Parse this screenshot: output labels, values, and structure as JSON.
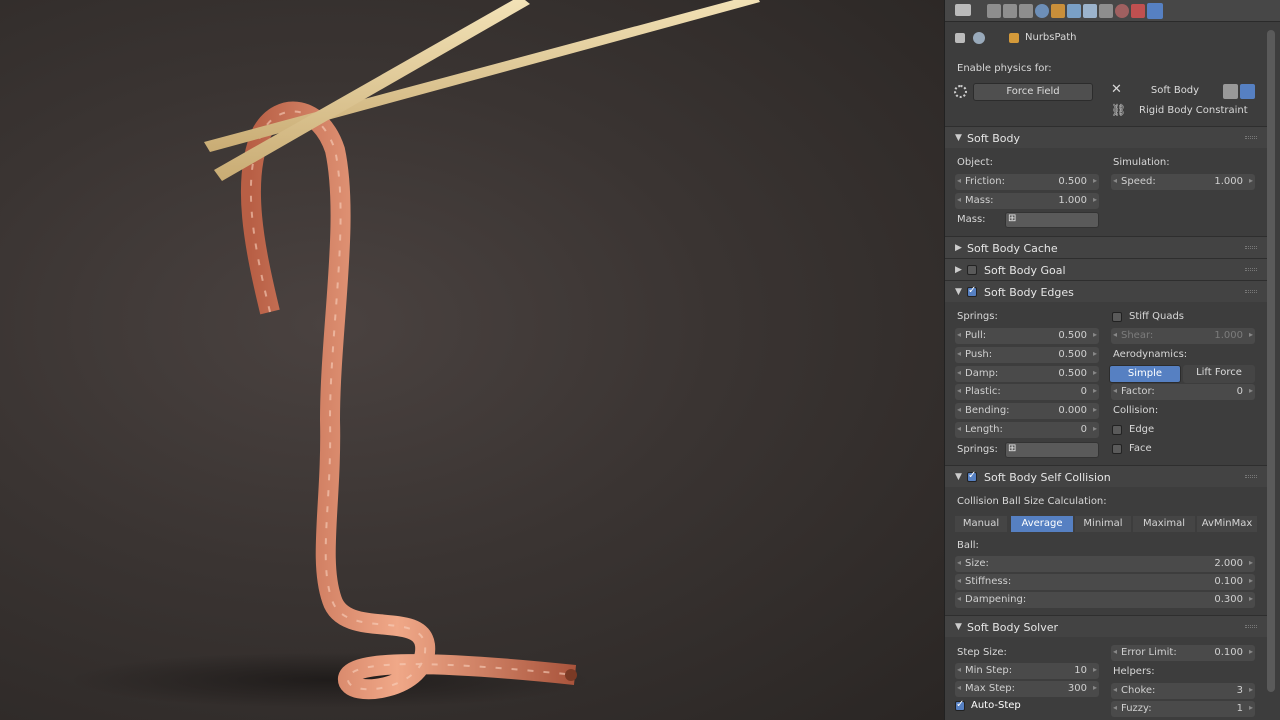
{
  "header": {
    "object_name": "NurbsPath"
  },
  "physics": {
    "enable_label": "Enable physics for:",
    "force_field": "Force Field",
    "soft_body": "Soft Body",
    "rigid_body_constraint": "Rigid Body Constraint"
  },
  "soft_body": {
    "title": "Soft Body",
    "object_label": "Object:",
    "simulation_label": "Simulation:",
    "friction_label": "Friction:",
    "friction": "0.500",
    "mass_label": "Mass:",
    "mass": "1.000",
    "speed_label": "Speed:",
    "speed": "1.000",
    "mass_group_label": "Mass:"
  },
  "cache": {
    "title": "Soft Body Cache"
  },
  "goal": {
    "title": "Soft Body Goal"
  },
  "edges": {
    "title": "Soft Body Edges",
    "springs_label": "Springs:",
    "pull_label": "Pull:",
    "pull": "0.500",
    "push_label": "Push:",
    "push": "0.500",
    "damp_label": "Damp:",
    "damp": "0.500",
    "plastic_label": "Plastic:",
    "plastic": "0",
    "bending_label": "Bending:",
    "bending": "0.000",
    "length_label": "Length:",
    "length": "0",
    "springs_group_label": "Springs:",
    "stiff_quads": "Stiff Quads",
    "shear_label": "Shear:",
    "shear": "1.000",
    "aero_label": "Aerodynamics:",
    "simple": "Simple",
    "lift_force": "Lift Force",
    "factor_label": "Factor:",
    "factor": "0",
    "collision_label": "Collision:",
    "edge": "Edge",
    "face": "Face"
  },
  "self_collision": {
    "title": "Soft Body Self Collision",
    "calc_label": "Collision Ball Size Calculation:",
    "modes": [
      "Manual",
      "Average",
      "Minimal",
      "Maximal",
      "AvMinMax"
    ],
    "ball_label": "Ball:",
    "size_label": "Size:",
    "size": "2.000",
    "stiffness_label": "Stiffness:",
    "stiffness": "0.100",
    "dampening_label": "Dampening:",
    "dampening": "0.300"
  },
  "solver": {
    "title": "Soft Body Solver",
    "step_size_label": "Step Size:",
    "min_step_label": "Min Step:",
    "min_step": "10",
    "max_step_label": "Max Step:",
    "max_step": "300",
    "auto_step": "Auto-Step",
    "error_limit_label": "Error Limit:",
    "error_limit": "0.100",
    "helpers_label": "Helpers:",
    "choke_label": "Choke:",
    "choke": "3",
    "fuzzy_label": "Fuzzy:",
    "fuzzy": "1"
  },
  "colors": {
    "accent": "#5680c2",
    "panel": "#3d3d3d",
    "rope": "#d88a6a",
    "chopstick": "#e8d2a0"
  }
}
